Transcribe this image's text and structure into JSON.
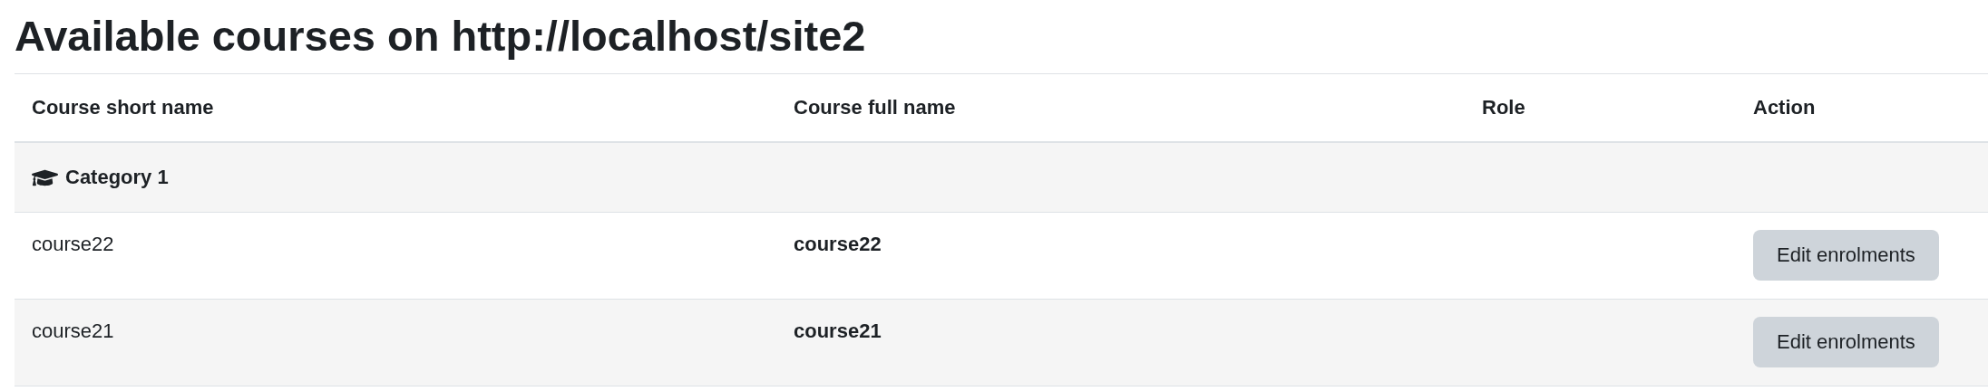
{
  "title": "Available courses on http://localhost/site2",
  "table": {
    "columns": [
      "Course short name",
      "Course full name",
      "Role",
      "Action"
    ],
    "category": {
      "label": "Category 1"
    },
    "rows": [
      {
        "short_name": "course22",
        "full_name": "course22",
        "action": "Edit enrolments"
      },
      {
        "short_name": "course21",
        "full_name": "course21",
        "action": "Edit enrolments"
      }
    ]
  }
}
